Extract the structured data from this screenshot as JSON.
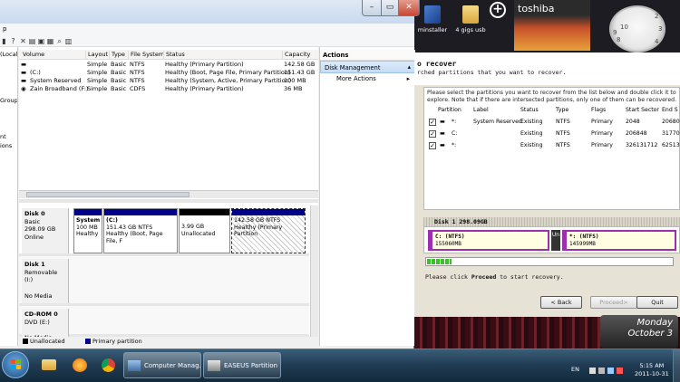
{
  "desktop": {
    "icon1_label": "minstaller",
    "icon2_label": "4 gigs usb",
    "add_label": "+",
    "tile_label": "toshiba",
    "clock_numbers": [
      "10",
      "2",
      "8",
      "4",
      "3",
      "9"
    ]
  },
  "computer_management": {
    "title_fragment": "p",
    "tree": [
      "(Local",
      "",
      "Groups",
      "",
      "nt",
      "ions",
      "",
      "",
      "",
      ""
    ],
    "columns": [
      "Volume",
      "Layout",
      "Type",
      "File System",
      "Status",
      "Capacity"
    ],
    "volumes": [
      {
        "name": "",
        "layout": "Simple",
        "type": "Basic",
        "fs": "NTFS",
        "status": "Healthy (Primary Partition)",
        "capacity": "142.58 GB"
      },
      {
        "name": "(C:)",
        "layout": "Simple",
        "type": "Basic",
        "fs": "NTFS",
        "status": "Healthy (Boot, Page File, Primary Partition)",
        "capacity": "151.43 GB"
      },
      {
        "name": "System Reserved",
        "layout": "Simple",
        "type": "Basic",
        "fs": "NTFS",
        "status": "Healthy (System, Active, Primary Partition)",
        "capacity": "100 MB"
      },
      {
        "name": "Zain Broadband (F:)",
        "layout": "Simple",
        "type": "Basic",
        "fs": "CDFS",
        "status": "Healthy (Primary Partition)",
        "capacity": "36 MB"
      }
    ],
    "disk0": {
      "name": "Disk 0",
      "type": "Basic",
      "size": "298.09 GB",
      "state": "Online"
    },
    "disk0_parts": [
      {
        "title": "System",
        "size": "100 MB",
        "status": "Healthy"
      },
      {
        "title": "(C:)",
        "size": "151.43 GB NTFS",
        "status": "Healthy (Boot, Page File, F"
      },
      {
        "title": "",
        "size": "3.99 GB",
        "status": "Unallocated"
      },
      {
        "title": "",
        "size": "142.58 GB NTFS",
        "status": "Healthy (Primary Partition"
      }
    ],
    "disk1": {
      "name": "Disk 1",
      "type": "Removable (I:)",
      "media": "No Media"
    },
    "cdrom": {
      "name": "CD-ROM 0",
      "type": "DVD (E:)",
      "media": "No Media"
    },
    "legend": {
      "unallocated": "Unallocated",
      "primary": "Primary partition"
    },
    "actions": {
      "title": "Actions",
      "selected": "Disk Management",
      "more": "More Actions"
    }
  },
  "easeus": {
    "title": "o recover",
    "subtitle": "rched partitions that you want to recover.",
    "instructions": "Please select the partitions you want to recover from the list below and double click it to explore. Note that if there are intersected partitions, only one of them can be recovered.",
    "columns": [
      "Partition",
      "Label",
      "Status",
      "Type",
      "Flags",
      "Start Sector",
      "End S"
    ],
    "rows": [
      {
        "checked": "✓",
        "partition": "*:",
        "label": "System Reserved",
        "status": "Existing",
        "type": "NTFS",
        "flags": "Primary",
        "start": "2048",
        "end": "20680"
      },
      {
        "checked": "✓",
        "partition": "C:",
        "label": "",
        "status": "Existing",
        "type": "NTFS",
        "flags": "Primary",
        "start": "206848",
        "end": "31770"
      },
      {
        "checked": "✓",
        "partition": "*:",
        "label": "",
        "status": "Existing",
        "type": "NTFS",
        "flags": "Primary",
        "start": "326131712",
        "end": "62513"
      }
    ],
    "disk_header": "Disk 1  298.09GB",
    "map": [
      {
        "name": "C: (NTFS)",
        "size": "155060MB"
      },
      {
        "name": "*: (NTFS)",
        "size": "145999MB"
      }
    ],
    "unallocated_label": "Un",
    "progress_fraction": 0.1,
    "status_prefix": "Please click ",
    "status_bold": "Proceed",
    "status_suffix": " to start recovery.",
    "buttons": {
      "back": "< Back",
      "proceed": "Proceed>",
      "quit": "Quit"
    }
  },
  "calendar_gadget": {
    "day": "Monday",
    "month_day": "October 3"
  },
  "taskbar": {
    "tasks": [
      "Computer Manag...",
      "EASEUS Partition ..."
    ],
    "language": "EN",
    "time": "5:15 AM",
    "date": "2011-10-31"
  }
}
